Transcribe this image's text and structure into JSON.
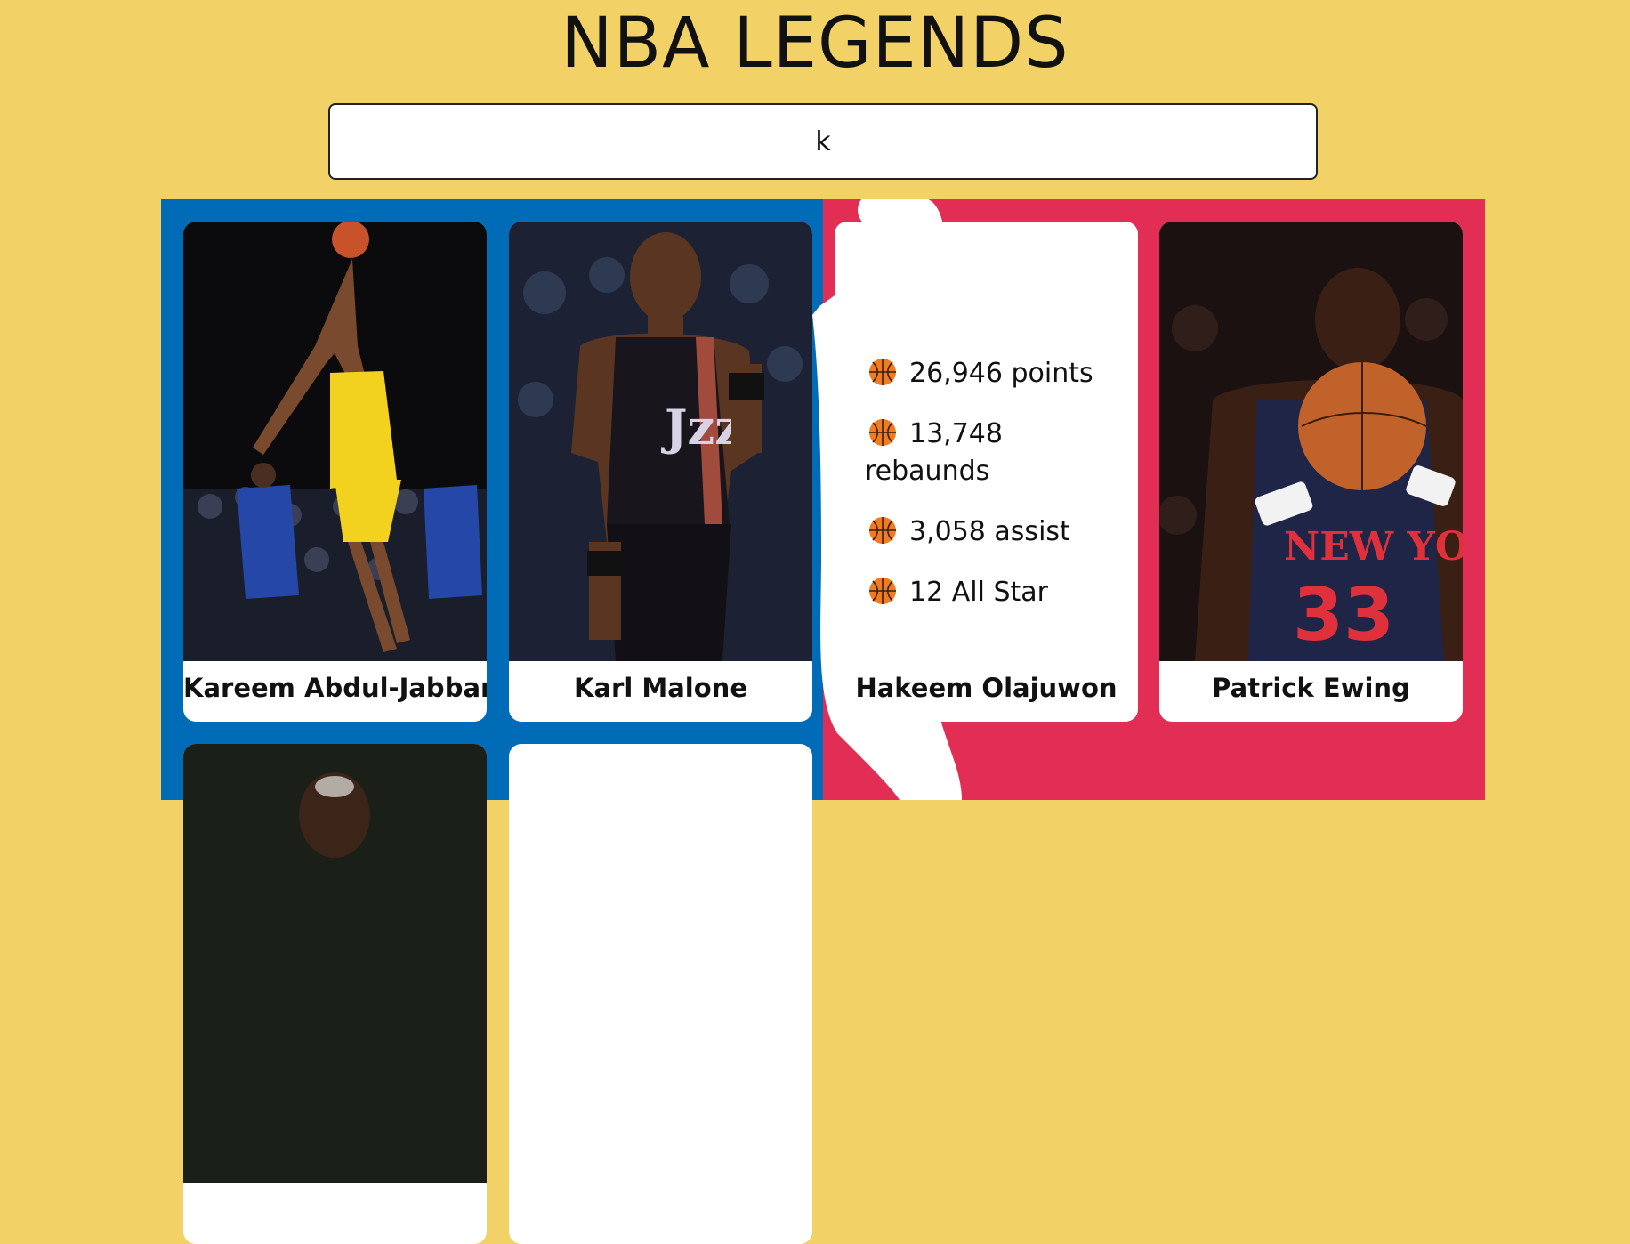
{
  "header": {
    "title": "NBA LEGENDS"
  },
  "search": {
    "value": "k",
    "placeholder": ""
  },
  "colors": {
    "background": "#f2d166",
    "logo_blue": "#006bb6",
    "logo_red": "#e22d55",
    "card": "#ffffff"
  },
  "cards": [
    {
      "name": "Kareem Abdul-Jabbar",
      "view": "photo"
    },
    {
      "name": "Karl Malone",
      "view": "photo"
    },
    {
      "name": "Hakeem Olajuwon",
      "view": "stats",
      "stats": [
        {
          "icon": "basketball-icon",
          "text": "26,946 points"
        },
        {
          "icon": "basketball-icon",
          "text": "13,748 rebaunds"
        },
        {
          "icon": "basketball-icon",
          "text": "3,058 assist"
        },
        {
          "icon": "basketball-icon",
          "text": "12 All Star"
        }
      ]
    },
    {
      "name": "Patrick Ewing",
      "view": "photo"
    },
    {
      "name": "",
      "view": "photo"
    },
    {
      "name": "",
      "view": "blank"
    }
  ]
}
